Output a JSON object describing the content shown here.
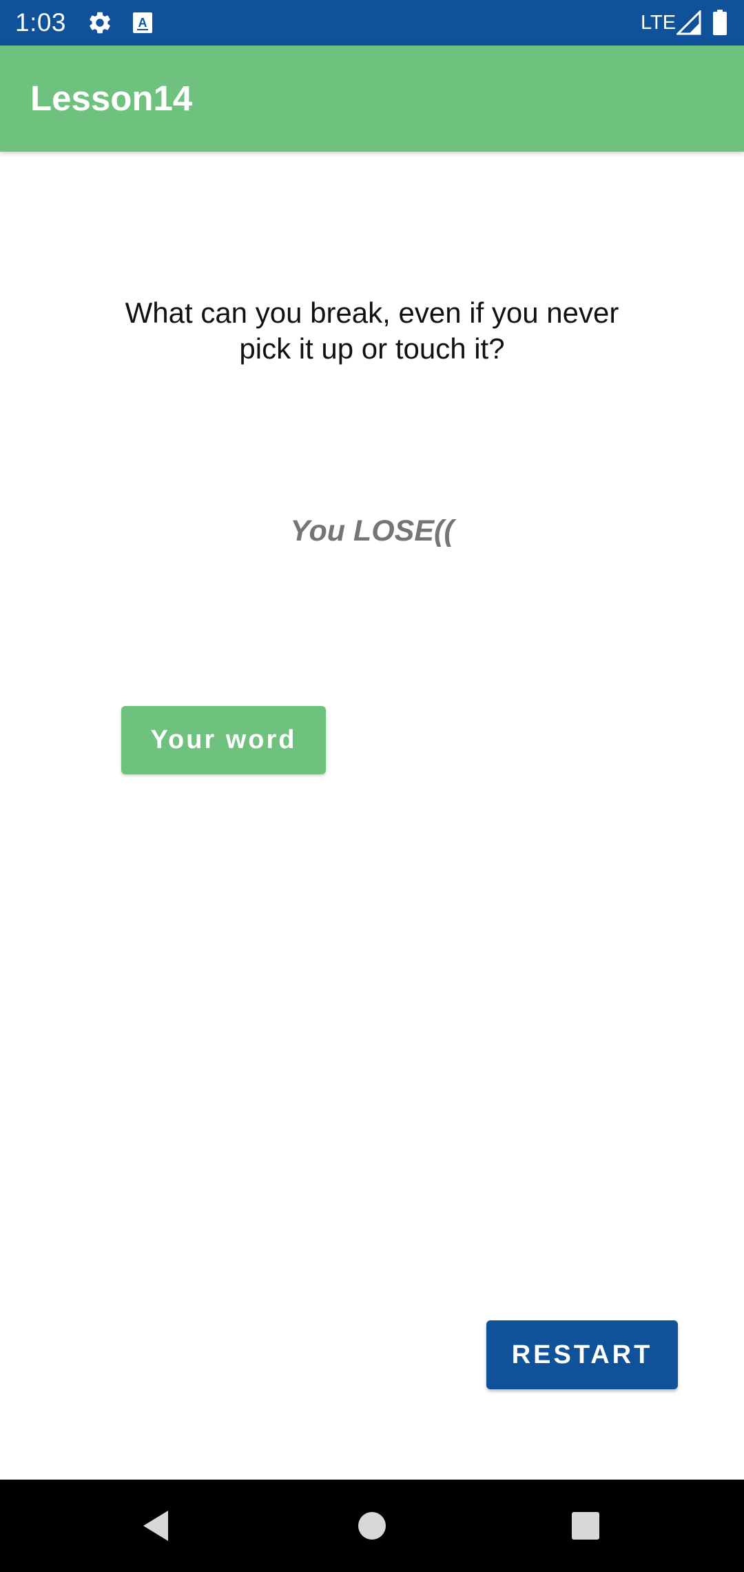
{
  "status_bar": {
    "time": "1:03",
    "network": "LTE",
    "icons": [
      "gear-icon",
      "keyboard-a-icon",
      "signal-icon",
      "battery-icon"
    ],
    "background_color": "#10529a"
  },
  "app_bar": {
    "title": "Lesson14",
    "background_color": "#6fc17e"
  },
  "main": {
    "question": "What can you break, even if you never pick it up or touch it?",
    "result": "You LOSE((",
    "word_button_label": "Your word",
    "restart_button_label": "RESTART"
  },
  "nav_bar": {
    "icons": [
      "back-icon",
      "home-icon",
      "recents-icon"
    ]
  },
  "colors": {
    "accent_green": "#6fc17e",
    "primary_blue": "#10529a",
    "result_gray": "#757575"
  }
}
